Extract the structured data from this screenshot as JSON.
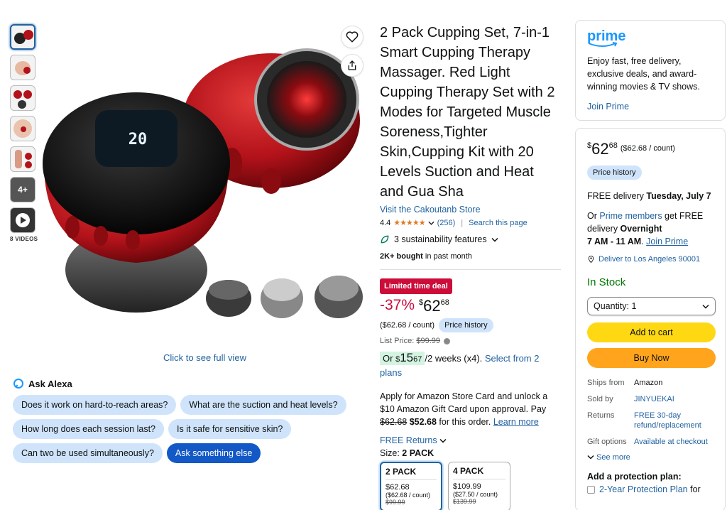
{
  "gallery": {
    "videos_label": "8 VIDEOS",
    "more_label": "4+",
    "see_full_view": "Click to see full view",
    "device_display": "20"
  },
  "alexa": {
    "title": "Ask Alexa",
    "questions": [
      "Does it work on hard-to-reach areas?",
      "What are the suction and heat levels?",
      "How long does each session last?",
      "Is it safe for sensitive skin?",
      "Can two be used simultaneously?"
    ],
    "ask_else": "Ask something else"
  },
  "product": {
    "title": "2 Pack Cupping Set, 7-in-1 Smart Cupping Therapy Massager. Red Light Cupping Therapy Set with 2 Modes for Targeted Muscle Soreness,Tighter Skin,Cupping Kit with 20 Levels Suction and Heat and Gua Sha",
    "store_link": "Visit the Cakoutanb Store",
    "rating": "4.4",
    "stars": "★★★★★",
    "review_count": "(256)",
    "search_page": "Search this page",
    "sustainability": "3 sustainability features",
    "bought_bold": "2K+ bought",
    "bought_rest": " in past month"
  },
  "pricing": {
    "deal_badge": "Limited time deal",
    "discount": "-37%",
    "currency": "$",
    "whole": "62",
    "fraction": "68",
    "unit_price": "($62.68 / count)",
    "price_history": "Price history",
    "list_price_label": "List Price: ",
    "list_price": "$99.99",
    "installment_or": "Or ",
    "installment_whole": "15",
    "installment_fraction": "67",
    "installment_terms": "/2 weeks (x4). ",
    "installment_link": "Select from 2 plans",
    "card_offer_1": "Apply for Amazon Store Card and unlock a $10 Amazon Gift Card upon approval. Pay ",
    "card_offer_strike": "$62.68",
    "card_offer_2": " $52.68",
    "card_offer_3": " for this order. ",
    "learn_more": "Learn more",
    "free_returns": "FREE Returns"
  },
  "size": {
    "label": "Size: ",
    "selected": "2 PACK",
    "options": [
      {
        "name": "2 PACK",
        "price": "$62.68",
        "unit": "($62.68 / count)",
        "list": "$99.99"
      },
      {
        "name": "4 PACK",
        "price": "$109.99",
        "unit": "($27.50 / count)",
        "list": "$139.99"
      }
    ]
  },
  "prime_box": {
    "logo": "prime",
    "text": "Enjoy fast, free delivery, exclusive deals, and award-winning movies & TV shows.",
    "join": "Join Prime"
  },
  "buy_box": {
    "unit_price": "($62.68 / count)",
    "price_history": "Price history",
    "delivery_prefix": "FREE delivery ",
    "delivery_date": "Tuesday, July 7",
    "prime_or": "Or ",
    "prime_members": "Prime members",
    "prime_mid": " get FREE delivery ",
    "overnight": "Overnight",
    "window": "7 AM - 11 AM",
    "join_prime": "Join Prime",
    "deliver_to": "Deliver to Los Angeles 90001",
    "stock": "In Stock",
    "quantity": "Quantity: 1",
    "add_to_cart": "Add to cart",
    "buy_now": "Buy Now",
    "details": [
      {
        "k": "Ships from",
        "v": "Amazon"
      },
      {
        "k": "Sold by",
        "v": "JINYUEKAI"
      },
      {
        "k": "Returns",
        "v": "FREE 30-day refund/replacement"
      },
      {
        "k": "Gift options",
        "v": "Available at checkout"
      }
    ],
    "see_more": "See more",
    "protection_title": "Add a protection plan:",
    "protection_option": "2-Year Protection Plan",
    "protection_for": " for"
  },
  "colors": {
    "link": "#2162a1",
    "deal": "#cc0c39",
    "add_to_cart": "#ffd814",
    "buy_now": "#ffa41c",
    "stock": "#007600",
    "device_red": "#b3121a"
  }
}
